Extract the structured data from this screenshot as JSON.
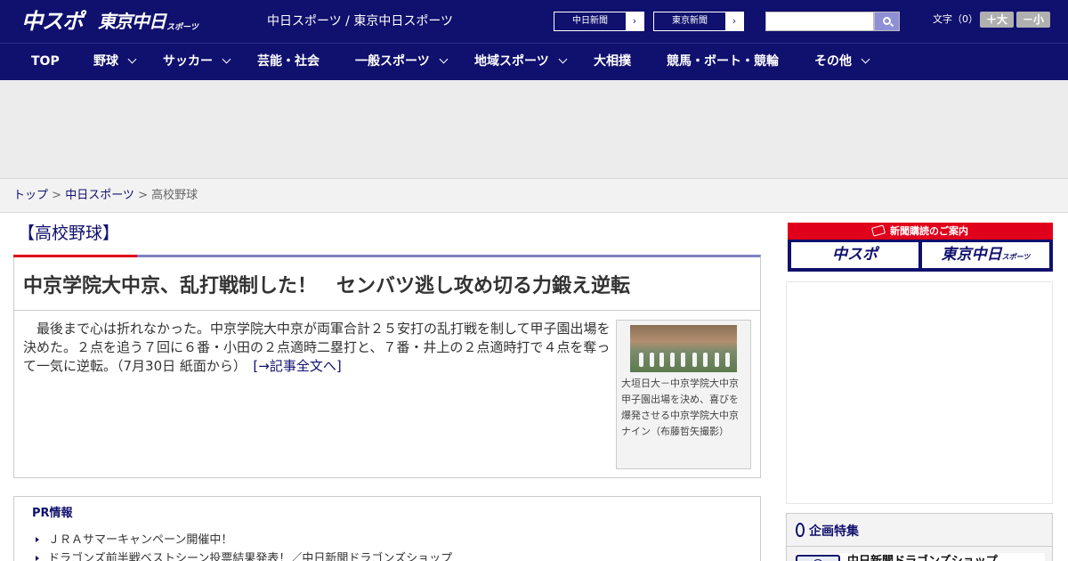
{
  "header": {
    "logo_chuspo": "中スポ",
    "logo_tokyo": "東京中日",
    "logo_tokyo_sub": "スポーツ",
    "site_names": "中日スポーツ / 東京中日スポーツ",
    "sister_links": [
      "中日新聞",
      "東京新聞"
    ],
    "search": {
      "value": "",
      "placeholder": ""
    },
    "font_size_label": "文字（0）",
    "font_bigger": "＋大",
    "font_smaller": "－小"
  },
  "nav": {
    "items": [
      {
        "label": "TOP",
        "has_menu": false
      },
      {
        "label": "野球",
        "has_menu": true
      },
      {
        "label": "サッカー",
        "has_menu": true
      },
      {
        "label": "芸能・社会",
        "has_menu": false
      },
      {
        "label": "一般スポーツ",
        "has_menu": true
      },
      {
        "label": "地域スポーツ",
        "has_menu": true
      },
      {
        "label": "大相撲",
        "has_menu": false
      },
      {
        "label": "競馬・ボート・競輪",
        "has_menu": false
      },
      {
        "label": "その他",
        "has_menu": true
      }
    ]
  },
  "breadcrumb": {
    "top": "トップ",
    "sep": " > ",
    "section": "中日スポーツ",
    "current": "高校野球"
  },
  "main": {
    "section_title": "【高校野球】",
    "article": {
      "headline": "中京学院大中京、乱打戦制した！　センバツ逃し攻め切る力鍛え逆転",
      "lead": "最後まで心は折れなかった。中京学院大中京が両軍合計２５安打の乱打戦を制して甲子園出場を決めた。２点を追う７回に６番・小田の２点適時二塁打と、７番・井上の２点適時打で４点を奪って一気に逆転。（7月30日 紙面から）",
      "more_link": "[→記事全文へ]",
      "photo_caption": "大垣日大－中京学院大中京　甲子園出場を決め、喜びを爆発させる中京学院大中京ナイン（布藤哲矢撮影）"
    },
    "pr": {
      "title": "PR情報",
      "items": [
        "ＪＲＡサマーキャンペーン開催中！",
        "ドラゴンズ前半戦ベストシーン投票結果発表！／中日新聞ドラゴンズショップ"
      ]
    }
  },
  "sidebar": {
    "subscribe_header": "新聞購読のご案内",
    "subscribe_chuspo": "中スポ",
    "subscribe_tokyo": "東京中日",
    "subscribe_tokyo_sub": "スポーツ",
    "feature_title": "企画特集",
    "feature_item": "中日新聞ドラゴンズショップ"
  },
  "colors": {
    "brand_navy": "#10106e",
    "accent_red": "#e0001b",
    "search_button": "#8f8fd6"
  },
  "icons": {
    "search": "search-icon",
    "sister_arrow": "chevron-right-icon",
    "nav_dropdown": "chevron-down-icon",
    "subscribe": "ticket-icon",
    "feature": "medal-icon",
    "pr_bullet": "triangle-bullet-icon"
  }
}
